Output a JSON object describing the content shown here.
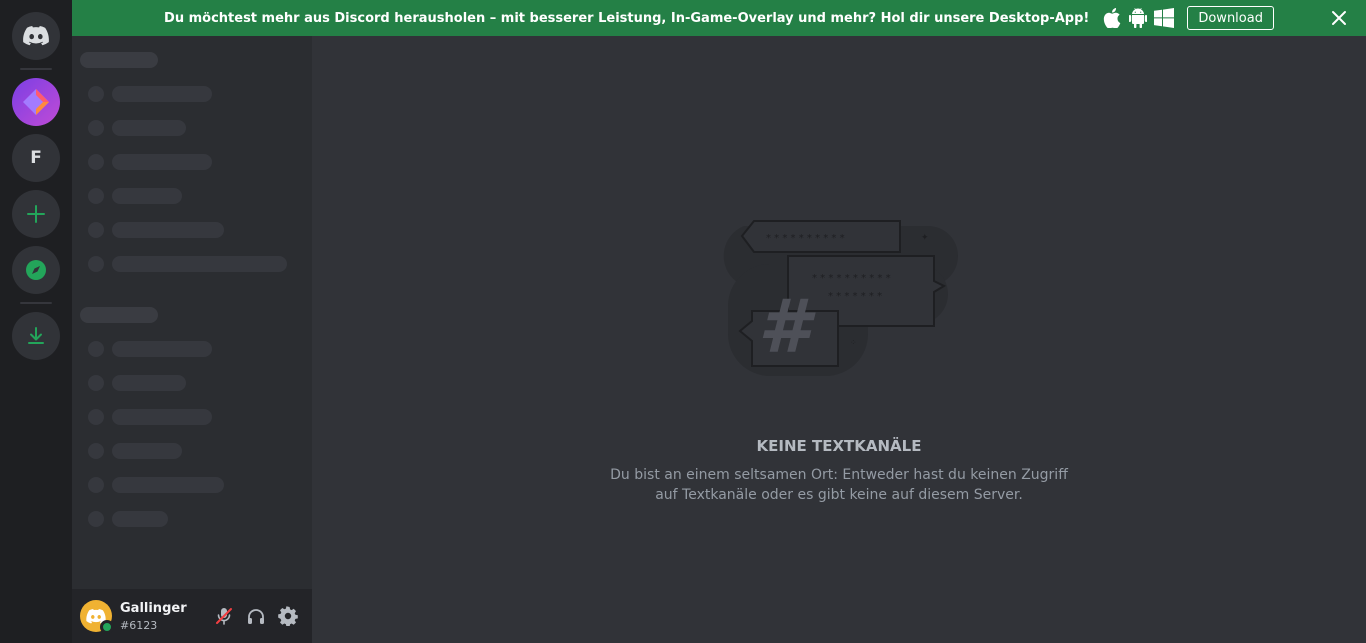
{
  "banner": {
    "text": "Du möchtest mehr aus Discord herausholen – mit besserer Leistung, In-Game-Overlay und mehr? Hol dir unsere Desktop-App!",
    "download_label": "Download",
    "platform_icons": [
      "apple-icon",
      "android-icon",
      "windows-icon"
    ]
  },
  "rail": {
    "server_initial": "F"
  },
  "empty_state": {
    "title": "KEINE TEXTKANÄLE",
    "description_line1": "Du bist an einem seltsamen Ort: Entweder hast du keinen Zugriff",
    "description_line2": "auf Textkanäle oder es gibt keine auf diesem Server."
  },
  "user": {
    "name": "Gallinger",
    "tag": "#6123",
    "status": "online"
  },
  "colors": {
    "brand": "#5865f2",
    "banner_green": "#248046",
    "online": "#23a55a",
    "add_green": "#23a55a"
  }
}
